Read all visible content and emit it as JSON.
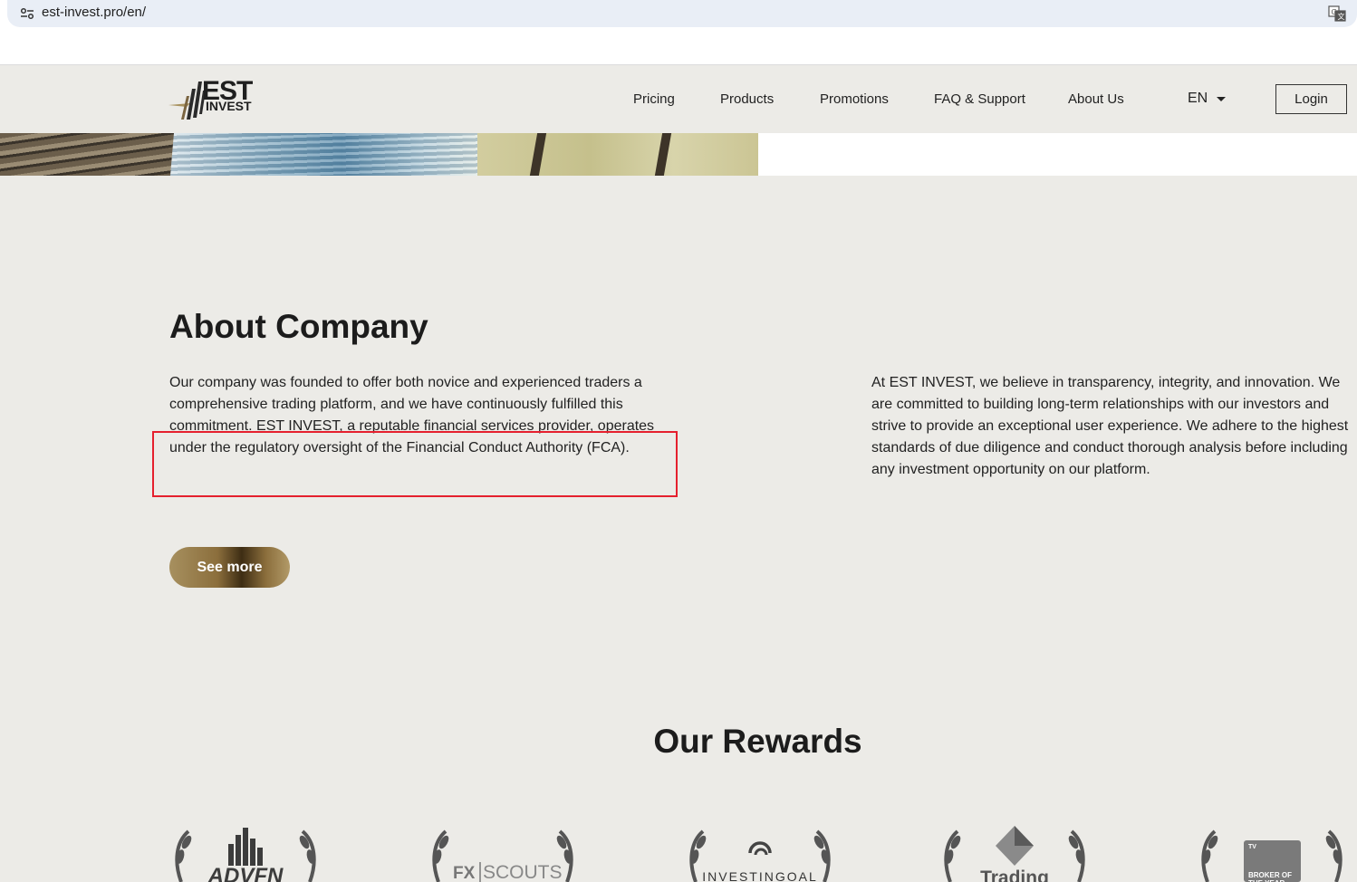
{
  "browser": {
    "url": "est-invest.pro/en/"
  },
  "header": {
    "logo_top": "EST",
    "logo_bottom": "INVEST",
    "nav": [
      {
        "label": "Pricing"
      },
      {
        "label": "Products"
      },
      {
        "label": "Promotions"
      },
      {
        "label": "FAQ & Support"
      },
      {
        "label": "About Us"
      }
    ],
    "language": "EN",
    "login_label": "Login"
  },
  "about": {
    "title": "About Company",
    "left_text": "Our company was founded to offer both novice and experienced traders a comprehensive trading platform, and we have continuously fulfilled this commitment. EST INVEST, a reputable financial services provider, operates under the regulatory oversight of the Financial Conduct Authority (FCA).",
    "right_text": "At EST INVEST, we believe in transparency, integrity, and innovation. We are committed to building long-term relationships with our investors and strive to provide an exceptional user experience. We adhere to the highest standards of due diligence and conduct thorough analysis before including any investment opportunity on our platform.",
    "see_more_label": "See more"
  },
  "rewards": {
    "title": "Our Rewards",
    "items": [
      {
        "label": "ADVFN"
      },
      {
        "label_a": "FX",
        "label_b": "SCOUTS"
      },
      {
        "label": "INVESTINGOAL"
      },
      {
        "label": "Trading"
      },
      {
        "label": "BROKER OF THE YEAR",
        "badge": "TV"
      }
    ]
  },
  "colors": {
    "background": "#ecebe7",
    "accent_gold": "#8b6e3c",
    "highlight_red": "#e5202e"
  }
}
